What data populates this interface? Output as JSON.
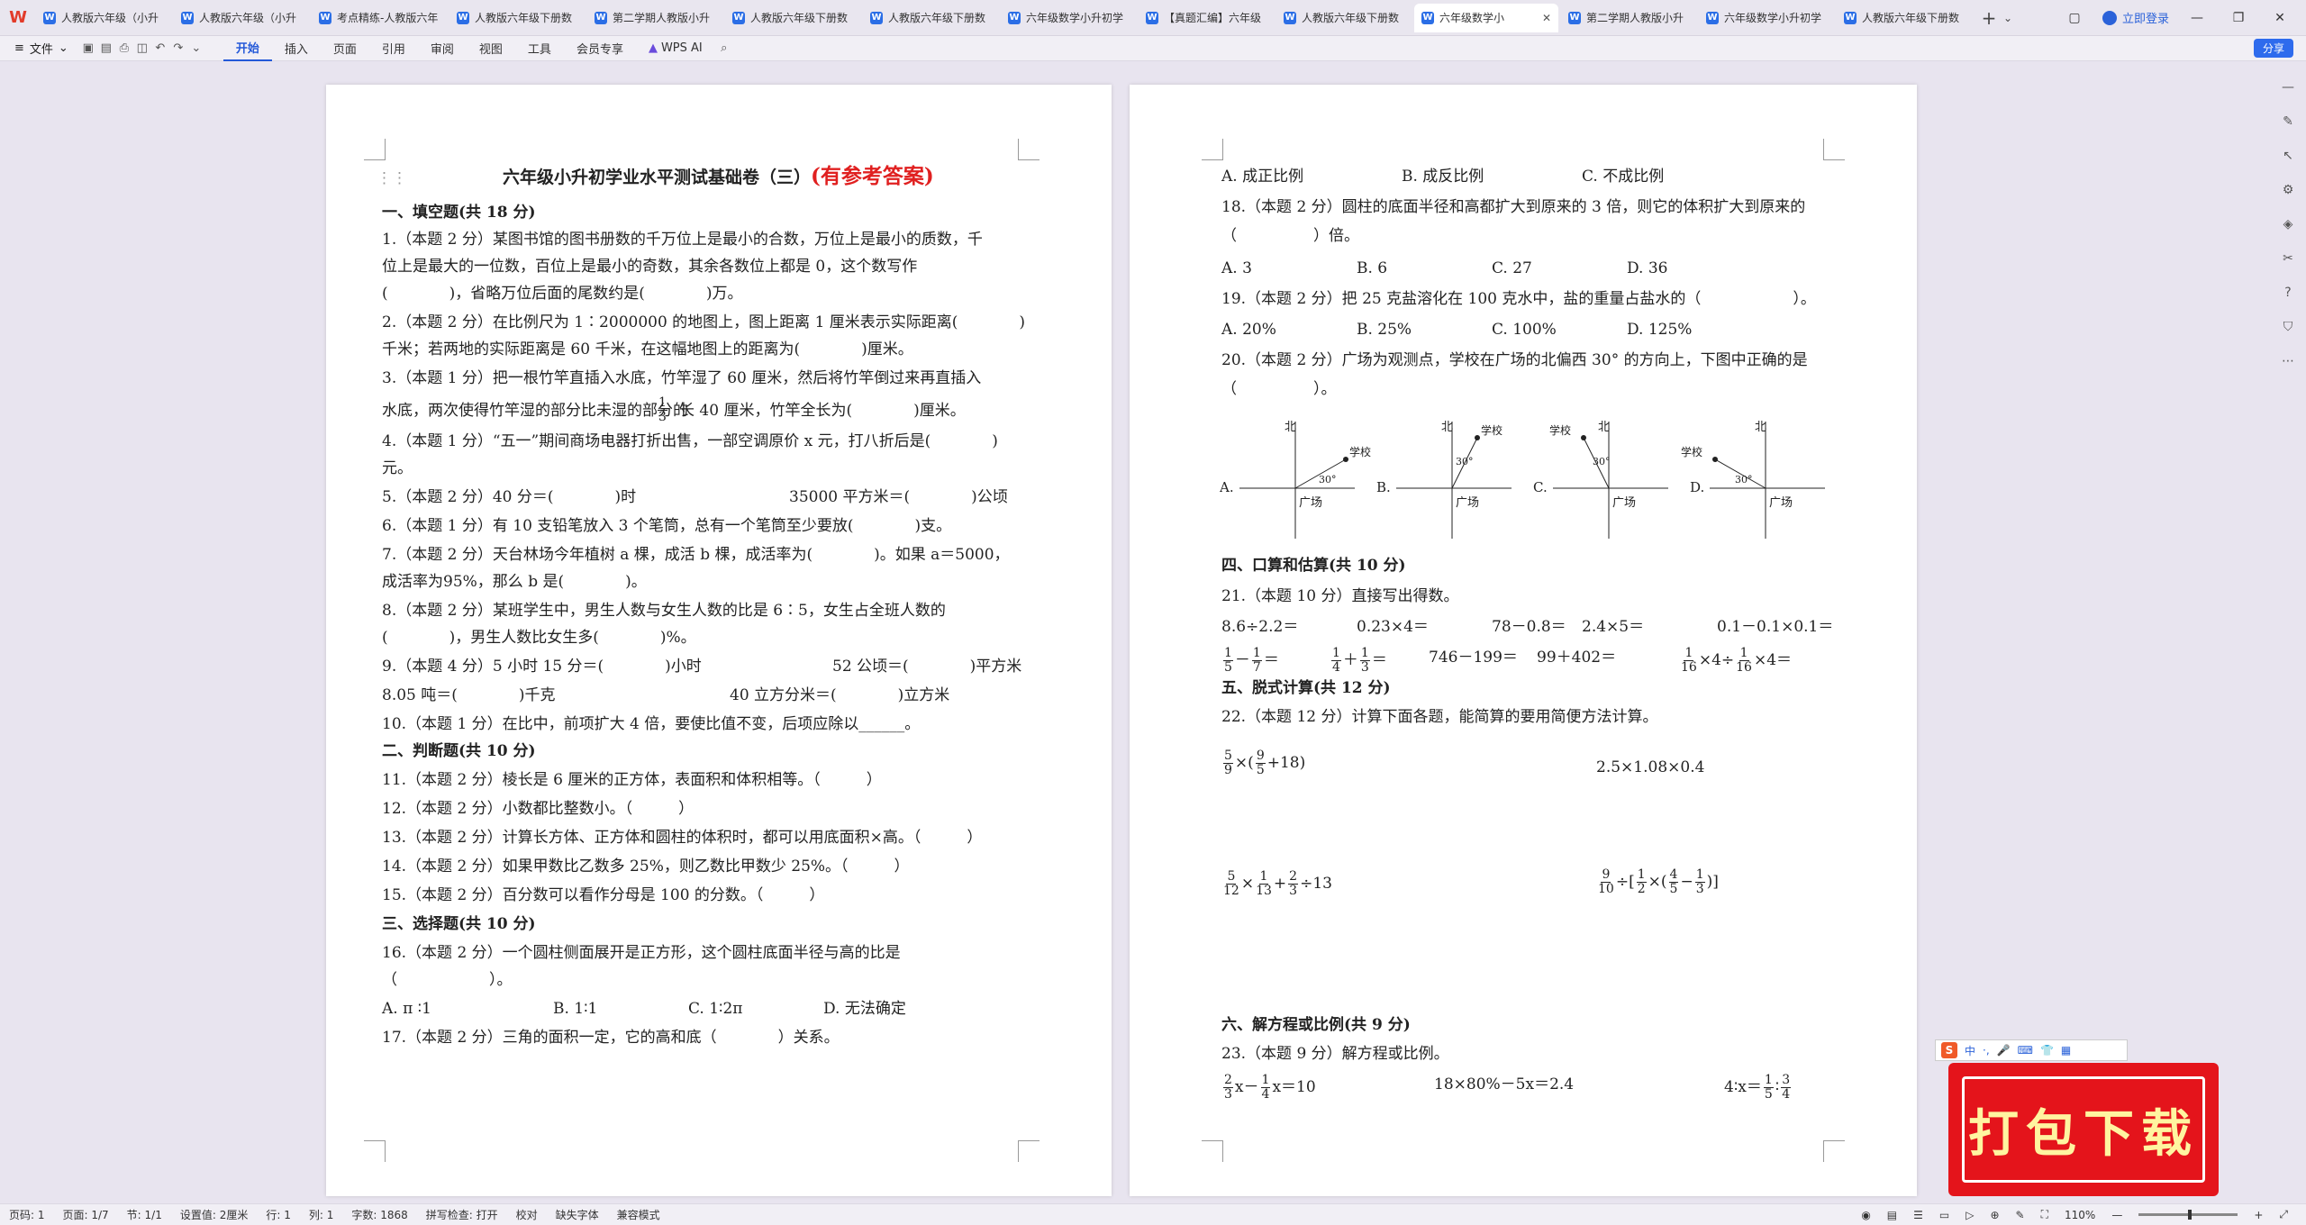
{
  "tabs": [
    {
      "label": "人教版六年级（小升"
    },
    {
      "label": "人教版六年级（小升"
    },
    {
      "label": "考点精练-人教版六年"
    },
    {
      "label": "人教版六年级下册数"
    },
    {
      "label": "第二学期人教版小升"
    },
    {
      "label": "人教版六年级下册数"
    },
    {
      "label": "人教版六年级下册数"
    },
    {
      "label": "六年级数学小升初学"
    },
    {
      "label": "【真题汇编】六年级"
    },
    {
      "label": "人教版六年级下册数"
    },
    {
      "label": "六年级数学小"
    },
    {
      "label": "第二学期人教版小升"
    },
    {
      "label": "六年级数学小升初学"
    },
    {
      "label": "人教版六年级下册数"
    }
  ],
  "titlebar": {
    "login": "立即登录",
    "add": "+"
  },
  "menubar": {
    "file": "文件",
    "items": [
      "开始",
      "插入",
      "页面",
      "引用",
      "审阅",
      "视图",
      "工具",
      "会员专享"
    ],
    "wps_ai": "WPS AI",
    "share": "分享"
  },
  "page1": {
    "title": "六年级小升初学业水平测试基础卷（三）",
    "title_red": "(有参考答案)",
    "lines": [
      "一、填空题(共 18 分)",
      "1.（本题 2 分）某图书馆的图书册数的千万位上是最小的合数，万位上是最小的质数，千",
      "位上是最大的一位数，百位上是最小的奇数，其余各数位上都是 0，这个数写作",
      "(　　　　)，省略万位后面的尾数约是(　　　　)万。",
      "2.（本题 2 分）在比例尺为 1∶2000000 的地图上，图上距离 1 厘米表示实际距离(　　　　)",
      "千米；若两地的实际距离是 60 千米，在这幅地图上的距离为(　　　　)厘米。",
      "3.（本题 1 分）把一根竹竿直插入水底，竹竿湿了 60 厘米，然后将竹竿倒过来再直插入",
      "水底，两次使得竹竿湿的部分比未湿的部分的",
      "长 40 厘米，竹竿全长为(　　　　)厘米。",
      "4.（本题 1 分）“五一”期间商场电器打折出售，一部空调原价 x 元，打八折后是(　　　　)",
      "元。",
      "5.（本题 2 分）40 分＝(　　　　)时",
      "35000 平方米＝(　　　　)公顷",
      "6.（本题 1 分）有 10 支铅笔放入 3 个笔筒，总有一个笔筒至少要放(　　　　)支。",
      "7.（本题 2 分）天台林场今年植树 a 棵，成活 b 棵，成活率为(　　　　)。如果 a＝5000，",
      "成活率为95%，那么 b 是(　　　　)。",
      "8.（本题 2 分）某班学生中，男生人数与女生人数的比是 6∶5，女生占全班人数的",
      "(　　　　)，男生人数比女生多(　　　　)%。",
      "9.（本题 4 分）5 小时 15 分＝(　　　　)小时",
      "52 公顷＝(　　　　)平方米",
      "8.05 吨＝(　　　　)千克",
      "40 立方分米＝(　　　　)立方米",
      "10.（本题 1 分）在比中，前项扩大 4 倍，要使比值不变，后项应除以______。",
      "二、判断题(共 10 分)",
      "11.（本题 2 分）棱长是 6 厘米的正方体，表面积和体积相等。（　　　）",
      "12.（本题 2 分）小数都比整数小。（　　　）",
      "13.（本题 2 分）计算长方体、正方体和圆柱的体积时，都可以用底面积×高。（　　　）",
      "14.（本题 2 分）如果甲数比乙数多 25%，则乙数比甲数少 25%。（　　　）",
      "15.（本题 2 分）百分数可以看作分母是 100 的分数。（　　　）",
      "三、选择题(共 10 分)",
      "16.（本题 2 分）一个圆柱侧面展开是正方形，这个圆柱底面半径与高的比是",
      "（　　　　　　）。",
      "A. π ∶1",
      "B. 1∶1",
      "C. 1∶2π",
      "D. 无法确定",
      "17.（本题 2 分）三角的面积一定，它的高和底（　　　　）关系。"
    ],
    "frac_third": {
      "n": "1",
      "d": "3"
    }
  },
  "page2": {
    "lines": [
      "A. 成正比例",
      "B. 成反比例",
      "C. 不成比例",
      "18.（本题 2 分）圆柱的底面半径和高都扩大到原来的 3 倍，则它的体积扩大到原来的",
      "（　　　　　）倍。",
      "A. 3",
      "B. 6",
      "C. 27",
      "D. 36",
      "19.（本题 2 分）把 25 克盐溶化在 100 克水中，盐的重量占盐水的（　　　　　　）。",
      "A. 20%",
      "B. 25%",
      "C. 100%",
      "D. 125%",
      "20.（本题 2 分）广场为观测点，学校在广场的北偏西 30° 的方向上，下图中正确的是",
      "（　　　　　）。",
      "四、口算和估算(共 10 分)",
      "21.（本题 10 分）直接写出得数。",
      "8.6÷2.2＝",
      "0.23×4＝",
      "78－0.8＝",
      "2.4×5＝",
      "0.1－0.1×0.1＝",
      "746－199＝",
      "99＋402＝",
      "五、脱式计算(共 12 分)",
      "22.（本题 12 分）计算下面各题，能简算的要用简便方法计算。",
      "2.5×1.08×0.4",
      "六、解方程或比例(共 9 分)",
      "23.（本题 9 分）解方程或比例。",
      "18×80%－5x＝2.4"
    ],
    "diagram": {
      "options": [
        "A.",
        "B.",
        "C.",
        "D."
      ],
      "north": "北",
      "school": "学校",
      "square": "广场",
      "angle": "30°"
    }
  },
  "ime": {
    "lang": "中"
  },
  "promo": {
    "text": "打包下载"
  },
  "statusbar": {
    "items": [
      "页码: 1",
      "页面: 1/7",
      "节: 1/1",
      "设置值: 2厘米",
      "行: 1",
      "列: 1",
      "字数: 1868",
      "拼写检查: 打开",
      "校对",
      "缺失字体",
      "兼容模式"
    ],
    "zoom": "110%"
  }
}
